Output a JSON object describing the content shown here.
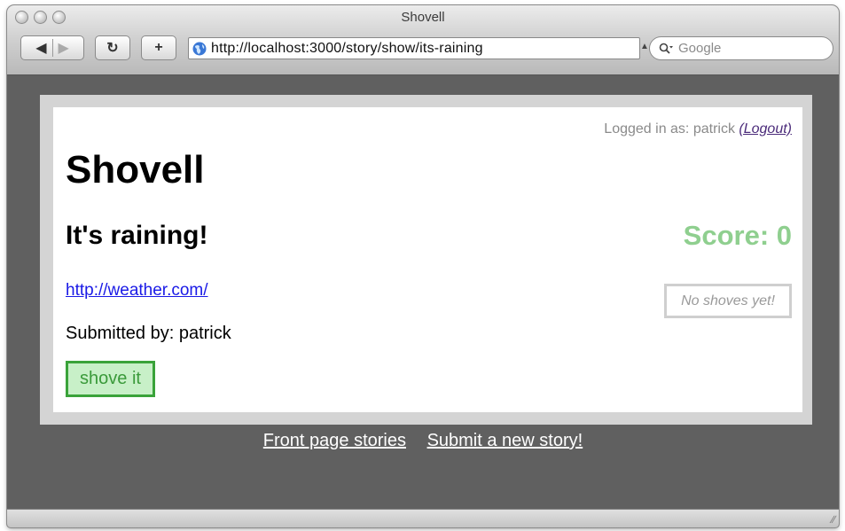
{
  "window": {
    "title": "Shovell"
  },
  "toolbar": {
    "back_icon": "back-arrow-icon",
    "forward_icon": "forward-arrow-icon",
    "reload_icon": "reload-icon",
    "add_label": "+",
    "url": "http://localhost:3000/story/show/its-raining",
    "search_placeholder": "Google"
  },
  "page": {
    "login_text": "Logged in as: patrick",
    "logout_label": "(Logout)",
    "site_title": "Shovell",
    "story_title": "It's raining!",
    "score": "Score: 0",
    "story_url": "http://weather.com/",
    "no_shoves": "No shoves yet!",
    "submitted_by": "Submitted by: patrick",
    "shove_button": "shove it"
  },
  "footer": {
    "links": [
      "Front page stories",
      "Submit a new story!"
    ]
  },
  "colors": {
    "score": "#8fcf8f",
    "shove_bg": "#c8f0c8",
    "shove_border": "#3aa33a",
    "link": "#1a1ae6",
    "page_bg": "#606060"
  }
}
